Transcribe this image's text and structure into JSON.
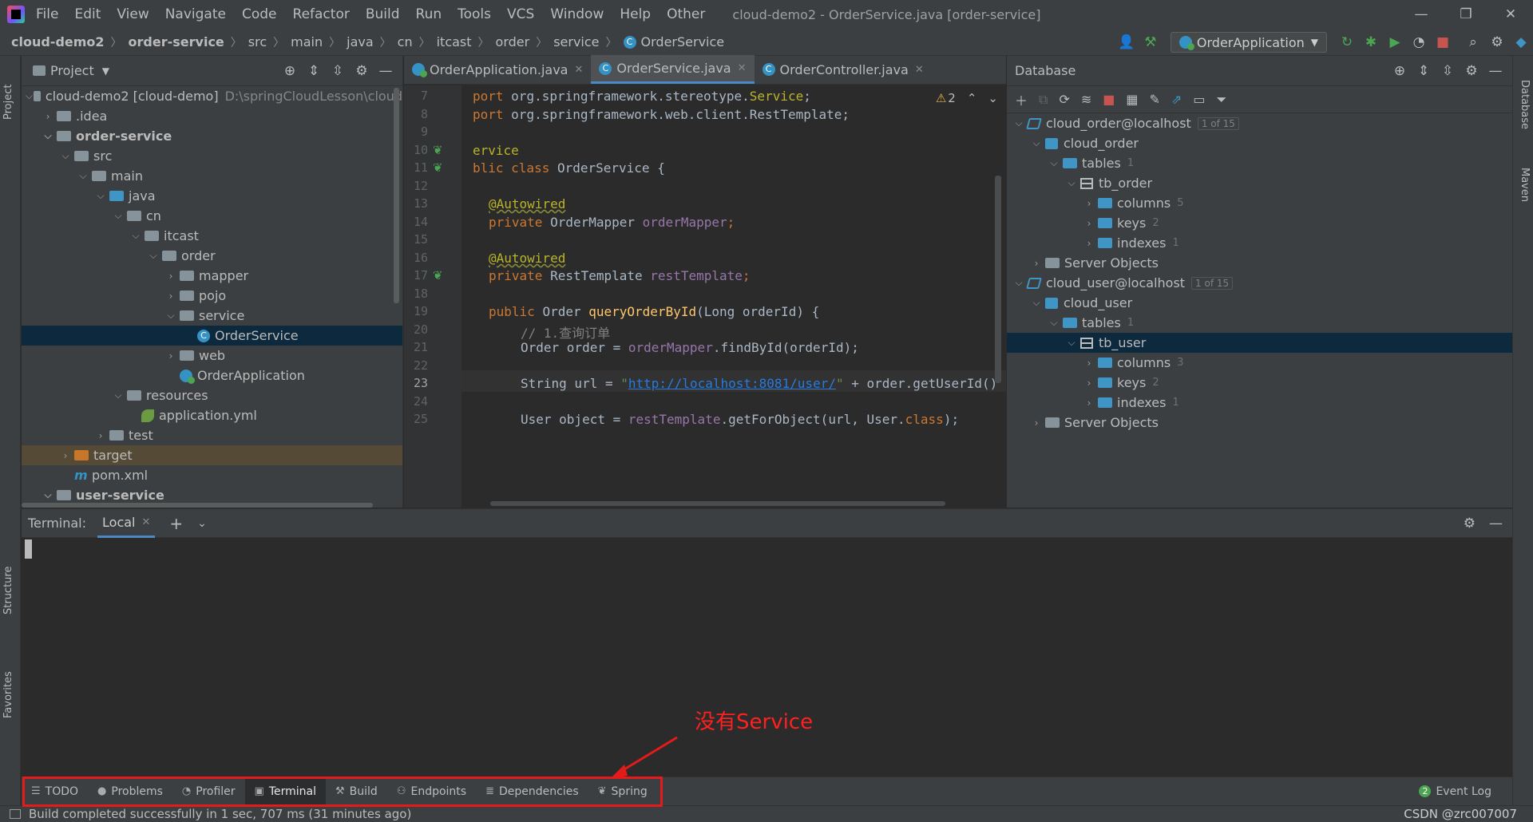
{
  "menubar": {
    "items": [
      "File",
      "Edit",
      "View",
      "Navigate",
      "Code",
      "Refactor",
      "Build",
      "Run",
      "Tools",
      "VCS",
      "Window",
      "Help",
      "Other"
    ],
    "title": "cloud-demo2 - OrderService.java [order-service]"
  },
  "navbar": {
    "crumbs": [
      "cloud-demo2",
      "order-service",
      "src",
      "main",
      "java",
      "cn",
      "itcast",
      "order",
      "service",
      "OrderService"
    ],
    "run_config": "OrderApplication"
  },
  "project": {
    "header": "Project",
    "root_label": "cloud-demo2 [cloud-demo]",
    "root_path": "D:\\springCloudLesson\\cloud",
    "rows": [
      ".idea",
      "order-service",
      "src",
      "main",
      "java",
      "cn",
      "itcast",
      "order",
      "mapper",
      "pojo",
      "service",
      "OrderService",
      "web",
      "OrderApplication",
      "resources",
      "application.yml",
      "test",
      "target",
      "pom.xml",
      "user-service"
    ]
  },
  "editor": {
    "tabs": [
      "OrderApplication.java",
      "OrderService.java",
      "OrderController.java"
    ],
    "warning_count": "2",
    "line_numbers": [
      "7",
      "8",
      "9",
      "10",
      "11",
      "12",
      "13",
      "14",
      "15",
      "16",
      "17",
      "18",
      "19",
      "20",
      "21",
      "22",
      "23",
      "24",
      "25"
    ],
    "lines": {
      "l7a": "port ",
      "l7b": "org.springframework.stereotype.",
      "l7c": "Service",
      "l7d": ";",
      "l8a": "port ",
      "l8b": "org.springframework.web.client.RestTemplate;",
      "l10": "ervice",
      "l11a": "blic class ",
      "l11b": "OrderService {",
      "l13": "@Autowired",
      "l14a": "private ",
      "l14b": "OrderMapper ",
      "l14c": "orderMapper",
      "l14d": ";",
      "l16": "@Autowired",
      "l17a": "private ",
      "l17b": "RestTemplate ",
      "l17c": "restTemplate",
      "l17d": ";",
      "l19a": "public ",
      "l19b": "Order ",
      "l19c": "queryOrderById",
      "l19d": "(Long orderId) {",
      "l20": "// 1.查询订单",
      "l21a": "Order order = ",
      "l21b": "orderMapper",
      "l21c": ".findById(orderId);",
      "l23a": "String url = ",
      "l23b": "\"",
      "l23c": "http://localhost:8081/user/",
      "l23d": "\"",
      "l23e": " + order.getUserId()",
      "l25a": "User object = ",
      "l25b": "restTemplate",
      "l25c": ".getForObject(url, User.",
      "l25d": "class",
      "l25e": ");"
    }
  },
  "database": {
    "header": "Database",
    "ds1": {
      "name": "cloud_order@localhost",
      "badge": "1 of 15",
      "schema": "cloud_order",
      "tables": "tables",
      "tables_count": "1",
      "table": "tb_order",
      "columns": "columns",
      "columns_count": "5",
      "keys": "keys",
      "keys_count": "2",
      "indexes": "indexes",
      "indexes_count": "1",
      "server": "Server Objects"
    },
    "ds2": {
      "name": "cloud_user@localhost",
      "badge": "1 of 15",
      "schema": "cloud_user",
      "tables": "tables",
      "tables_count": "1",
      "table": "tb_user",
      "columns": "columns",
      "columns_count": "3",
      "keys": "keys",
      "keys_count": "2",
      "indexes": "indexes",
      "indexes_count": "1",
      "server": "Server Objects"
    }
  },
  "terminal": {
    "label": "Terminal:",
    "tab": "Local"
  },
  "bottom_tabs": [
    "TODO",
    "Problems",
    "Profiler",
    "Terminal",
    "Build",
    "Endpoints",
    "Dependencies",
    "Spring"
  ],
  "event_log": {
    "count": "2",
    "label": "Event Log"
  },
  "status": {
    "message": "Build completed successfully in 1 sec, 707 ms (31 minutes ago)",
    "watermark": "CSDN @zrc007007"
  },
  "side_tabs": {
    "project": "Project",
    "structure": "Structure",
    "favorites": "Favorites",
    "database": "Database",
    "maven": "Maven"
  },
  "annotation": "没有Service",
  "colors": {
    "accent": "#4a88c7",
    "annotation": "#e31b1b",
    "selection": "#0d293e"
  }
}
